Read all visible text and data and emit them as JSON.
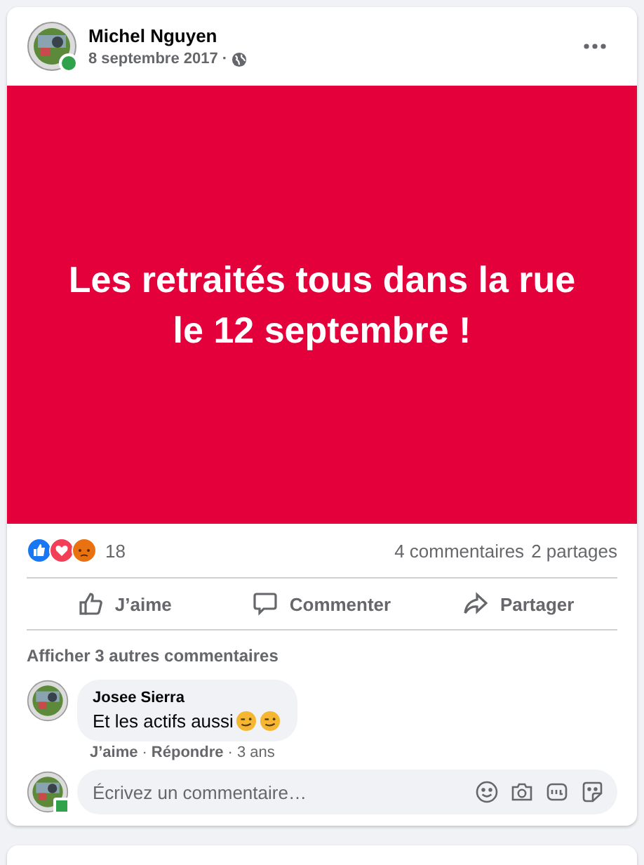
{
  "post": {
    "author": "Michel Nguyen",
    "online": true,
    "date": "8 septembre 2017",
    "separator": "·",
    "banner_text": "Les retraités tous dans la rue le 12 septembre !",
    "reaction_count": "18",
    "comments_count": "4 commentaires",
    "shares_count": "2 partages",
    "actions": [
      {
        "kind": "like",
        "label": "J’aime"
      },
      {
        "kind": "comment",
        "label": "Commenter"
      },
      {
        "kind": "share",
        "label": "Partager"
      }
    ],
    "more_comments": "Afficher 3 autres commentaires",
    "comments": [
      {
        "author": "Josee Sierra",
        "text": "Et les actifs aussi",
        "emojis": [
          {
            "kind": "wink"
          },
          {
            "kind": "wink"
          }
        ],
        "like": "J’aime",
        "separator": "·",
        "reply": "Répondre",
        "age": "3 ans"
      }
    ],
    "composer": {
      "placeholder": "Écrivez un commentaire…",
      "online": true
    }
  }
}
